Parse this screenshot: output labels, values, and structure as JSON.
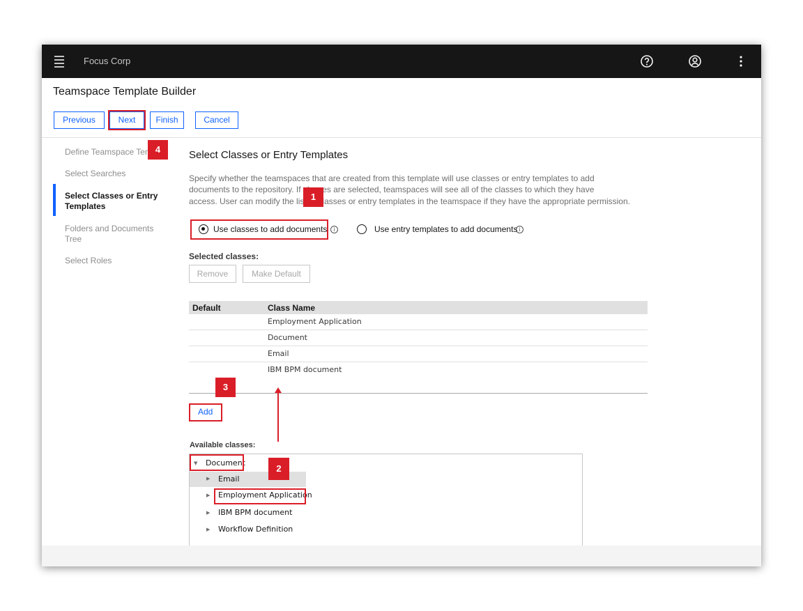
{
  "app": {
    "brand": "Focus Corp",
    "title": "Teamspace Template Builder"
  },
  "topbar": {
    "help_icon": "help-icon",
    "user_icon": "user-avatar-icon",
    "menu_icon": "overflow-menu-icon"
  },
  "toolbar": {
    "previous": "Previous",
    "next": "Next",
    "finish": "Finish",
    "cancel": "Cancel"
  },
  "sidebar": {
    "items": [
      {
        "label": "Define Teamspace Template"
      },
      {
        "label": "Select Searches"
      },
      {
        "label": "Select Classes or Entry Templates",
        "active": true
      },
      {
        "label": "Folders and Documents Tree"
      },
      {
        "label": "Select Roles"
      }
    ]
  },
  "main": {
    "title": "Select Classes or Entry Templates",
    "description_lines": [
      "Specify whether the teamspaces that are created from this template will use classes or entry templates to add",
      "documents to the repository. If classes are selected, teamspaces will see all of the classes to which they have",
      "access. User can modify the list of classes or entry templates in the teamspace if they have the appropriate permission."
    ],
    "option_classes": "Use classes to add documents",
    "option_templates": "Use entry templates to add documents",
    "selected_label": "Selected classes:",
    "remove": "Remove",
    "make_default": "Make Default",
    "table": {
      "headers": [
        "Default",
        "Class Name"
      ],
      "rows": [
        "Employment Application",
        "Document",
        "Email",
        "IBM BPM document"
      ]
    },
    "add": "Add",
    "available_label": "Available classes:",
    "tree": {
      "root": "Document",
      "children": [
        "Email",
        "Employment Application",
        "IBM BPM document",
        "Workflow Definition"
      ]
    }
  },
  "annotations": [
    "1",
    "2",
    "3",
    "4"
  ],
  "colors": {
    "accent": "#0f62fe",
    "annotation": "#da1e28",
    "topbar": "#161616"
  }
}
